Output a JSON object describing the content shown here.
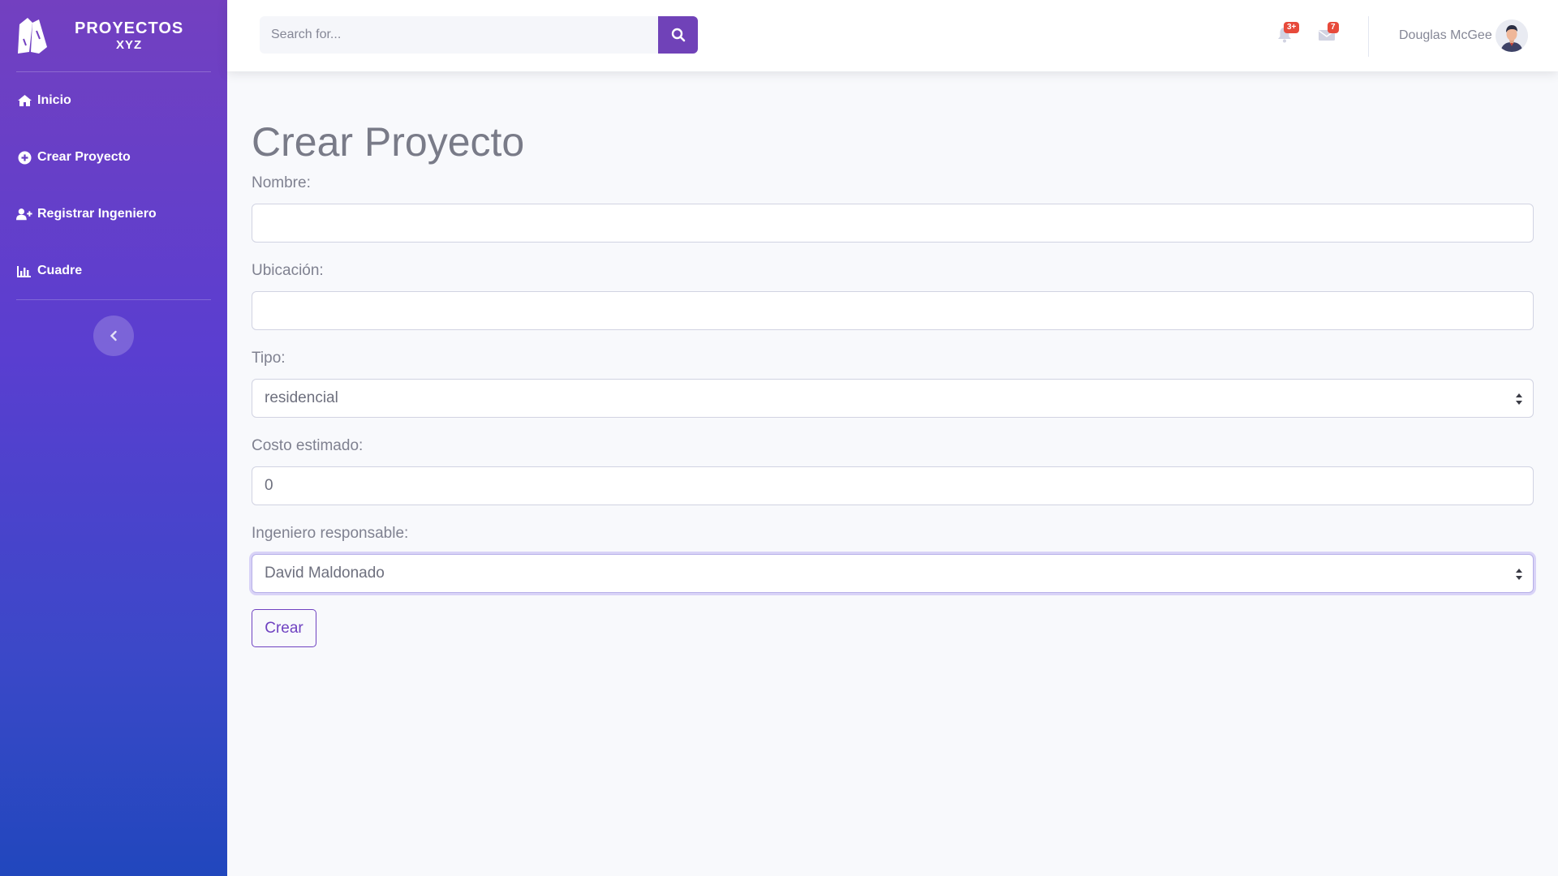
{
  "brand": {
    "line1": "PROYECTOS",
    "line2": "XYZ",
    "logo_icon": "wood-logo-icon"
  },
  "sidebar": {
    "items": [
      {
        "label": "Inicio",
        "icon": "home-icon"
      },
      {
        "label": "Crear Proyecto",
        "icon": "plus-circle-icon"
      },
      {
        "label": "Registrar Ingeniero",
        "icon": "user-plus-icon"
      },
      {
        "label": "Cuadre",
        "icon": "chart-bar-icon"
      }
    ],
    "toggle_icon": "chevron-left-icon"
  },
  "topbar": {
    "search_placeholder": "Search for...",
    "search_icon": "search-icon",
    "alerts_count": "3+",
    "messages_count": "7",
    "user_name": "Douglas McGee"
  },
  "form": {
    "title": "Crear Proyecto",
    "nombre_label": "Nombre:",
    "nombre_value": "",
    "ubicacion_label": "Ubicación:",
    "ubicacion_value": "",
    "tipo_label": "Tipo:",
    "tipo_value": "residencial",
    "costo_label": "Costo estimado:",
    "costo_value": "0",
    "ingeniero_label": "Ingeniero responsable:",
    "ingeniero_value": "David Maldonado",
    "submit_label": "Crear"
  },
  "colors": {
    "primary": "#6f42c1",
    "sidebar_top": "#7340c0",
    "sidebar_bottom": "#2147bd",
    "badge": "#e74a3b"
  }
}
